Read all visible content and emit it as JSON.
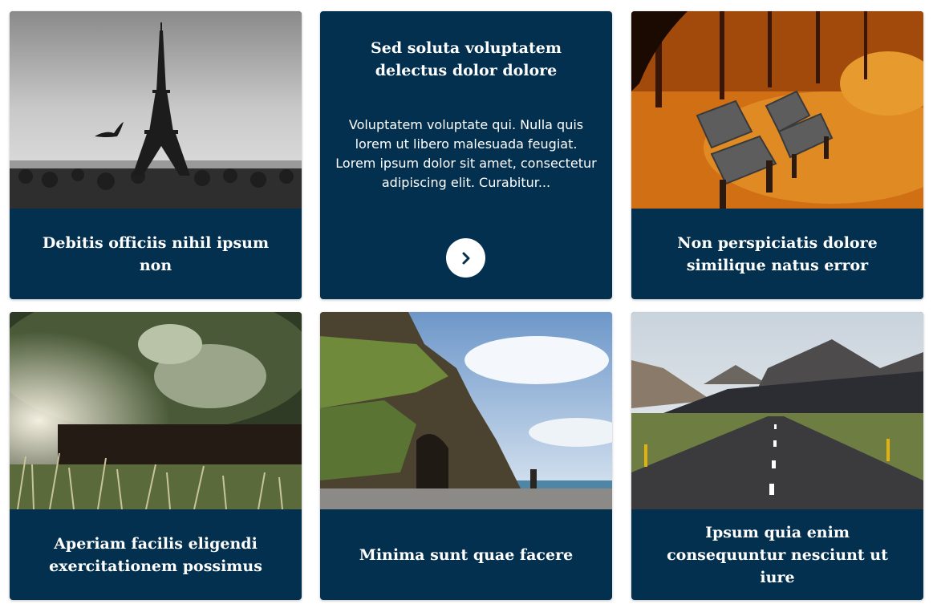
{
  "cards": [
    {
      "image": "eiffel-tower-photo",
      "title": "Debitis officiis nihil ipsum non"
    },
    {
      "title": "Sed soluta voluptatem delectus dolor dolore",
      "text": "Voluptatem voluptate qui. Nulla quis lorem ut libero malesuada feugiat. Lorem ipsum dolor sit amet, consectetur adipiscing elit. Curabitur...",
      "button_icon": "chevron-right-icon"
    },
    {
      "image": "autumn-benches-photo",
      "title": "Non perspiciatis dolore similique natus error"
    },
    {
      "image": "blurred-grass-photo",
      "title": "Aperiam facilis eligendi exercitationem possimus"
    },
    {
      "image": "coastal-cliff-photo",
      "title": "Minima sunt quae facere"
    },
    {
      "image": "mountain-road-photo",
      "title": "Ipsum quia enim consequuntur nesciunt ut iure"
    }
  ],
  "colors": {
    "card_background": "#04304f",
    "text": "#ffffff",
    "button_background": "#ffffff",
    "button_icon": "#04304f"
  }
}
